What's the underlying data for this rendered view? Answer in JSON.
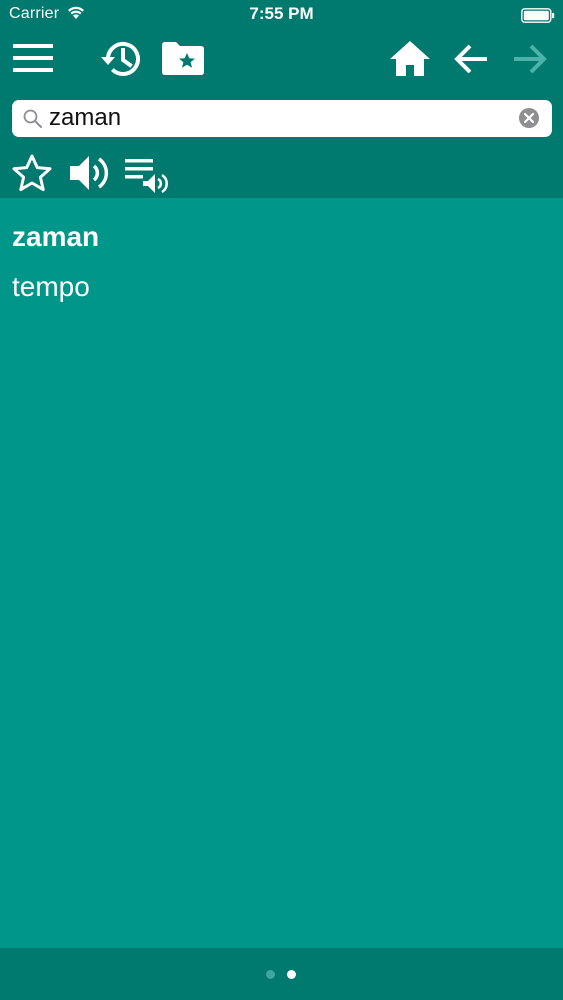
{
  "status_bar": {
    "carrier": "Carrier",
    "time": "7:55 PM"
  },
  "toolbar": {
    "icons": [
      "menu-icon",
      "history-icon",
      "favorites-folder-icon",
      "home-icon",
      "back-arrow-icon",
      "forward-arrow-icon"
    ],
    "actions": [
      "star-icon",
      "speaker-icon",
      "playlist-audio-icon"
    ]
  },
  "search": {
    "value": "zaman",
    "placeholder": ""
  },
  "entry": {
    "headword": "zaman",
    "translation": "tempo"
  },
  "pager": {
    "pages": 2,
    "current": 2
  },
  "colors": {
    "bar": "#00796e",
    "content": "#00968a",
    "forward_disabled": "#4db3a9"
  }
}
